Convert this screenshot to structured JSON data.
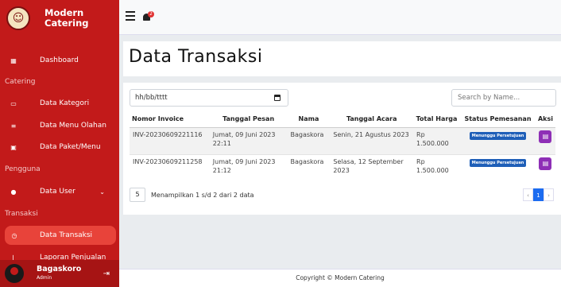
{
  "brand": {
    "name_line1": "Modern",
    "name_line2": "Catering",
    "logo_icon": "chef-logo"
  },
  "sidebar": {
    "dashboard": "Dashboard",
    "section_catering": "Catering",
    "kategori": "Data Kategori",
    "menu_olahan": "Data Menu Olahan",
    "paket_menu": "Data Paket/Menu",
    "section_pengguna": "Pengguna",
    "user": "Data User",
    "section_transaksi": "Transaksi",
    "transaksi": "Data Transaksi",
    "laporan": "Laporan Penjualan"
  },
  "profile": {
    "name": "Bagaskoro",
    "role": "Admin"
  },
  "topbar": {
    "notification_count": "2"
  },
  "page": {
    "title": "Data Transaksi"
  },
  "filters": {
    "date_value": "hh/bb/tttt",
    "search_placeholder": "Search by Name..."
  },
  "table": {
    "headers": [
      "Nomor Invoice",
      "Tanggal Pesan",
      "Nama",
      "Tanggal Acara",
      "Total Harga",
      "Status Pemesanan",
      "Aksi"
    ],
    "rows": [
      {
        "invoice": "INV-20230609221116",
        "tanggal_pesan": "Jumat, 09 Juni 2023 22:11",
        "nama": "Bagaskora",
        "tanggal_acara": "Senin, 21 Agustus 2023",
        "total": "Rp 1.500.000",
        "status": "Menunggu Persetujuan"
      },
      {
        "invoice": "INV-20230609211258",
        "tanggal_pesan": "Jumat, 09 Juni 2023 21:12",
        "nama": "Bagaskora",
        "tanggal_acara": "Selasa, 12 September 2023",
        "total": "Rp 1.500.000",
        "status": "Menunggu Persetujuan"
      }
    ]
  },
  "pagination": {
    "page_size": "5",
    "info": "Menampilkan 1 s/d 2 dari 2 data",
    "current_page": "1",
    "prev": "‹",
    "next": "›"
  },
  "footer": {
    "text": "Copyright © Modern Catering"
  }
}
